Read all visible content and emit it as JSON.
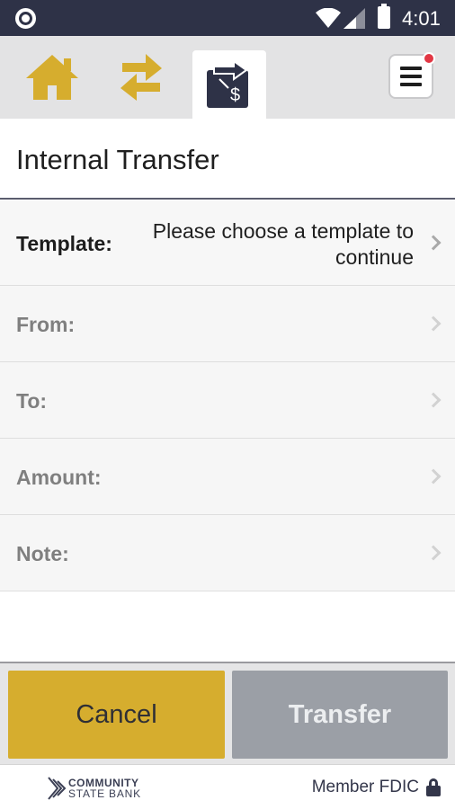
{
  "status_bar": {
    "time": "4:01"
  },
  "nav": {
    "items": [
      {
        "name": "home",
        "icon": "home-icon"
      },
      {
        "name": "transfer",
        "icon": "transfer-arrows-icon"
      },
      {
        "name": "pay",
        "icon": "payment-icon",
        "active": true
      }
    ],
    "menu_icon": "hamburger-menu-icon",
    "notification": true
  },
  "page": {
    "title": "Internal Transfer"
  },
  "form": {
    "template": {
      "label": "Template:",
      "value": "Please choose a template to continue"
    },
    "from": {
      "label": "From:"
    },
    "to": {
      "label": "To:"
    },
    "amount": {
      "label": "Amount:"
    },
    "note": {
      "label": "Note:"
    }
  },
  "actions": {
    "cancel": "Cancel",
    "transfer": "Transfer"
  },
  "footer": {
    "logo_line1": "COMMUNITY",
    "logo_line2": "STATE BANK",
    "member": "Member FDIC"
  },
  "colors": {
    "accent": "#d6ad2e",
    "status_bar": "#2e3247",
    "disabled": "#9b9fa6",
    "notification": "#e23744"
  }
}
